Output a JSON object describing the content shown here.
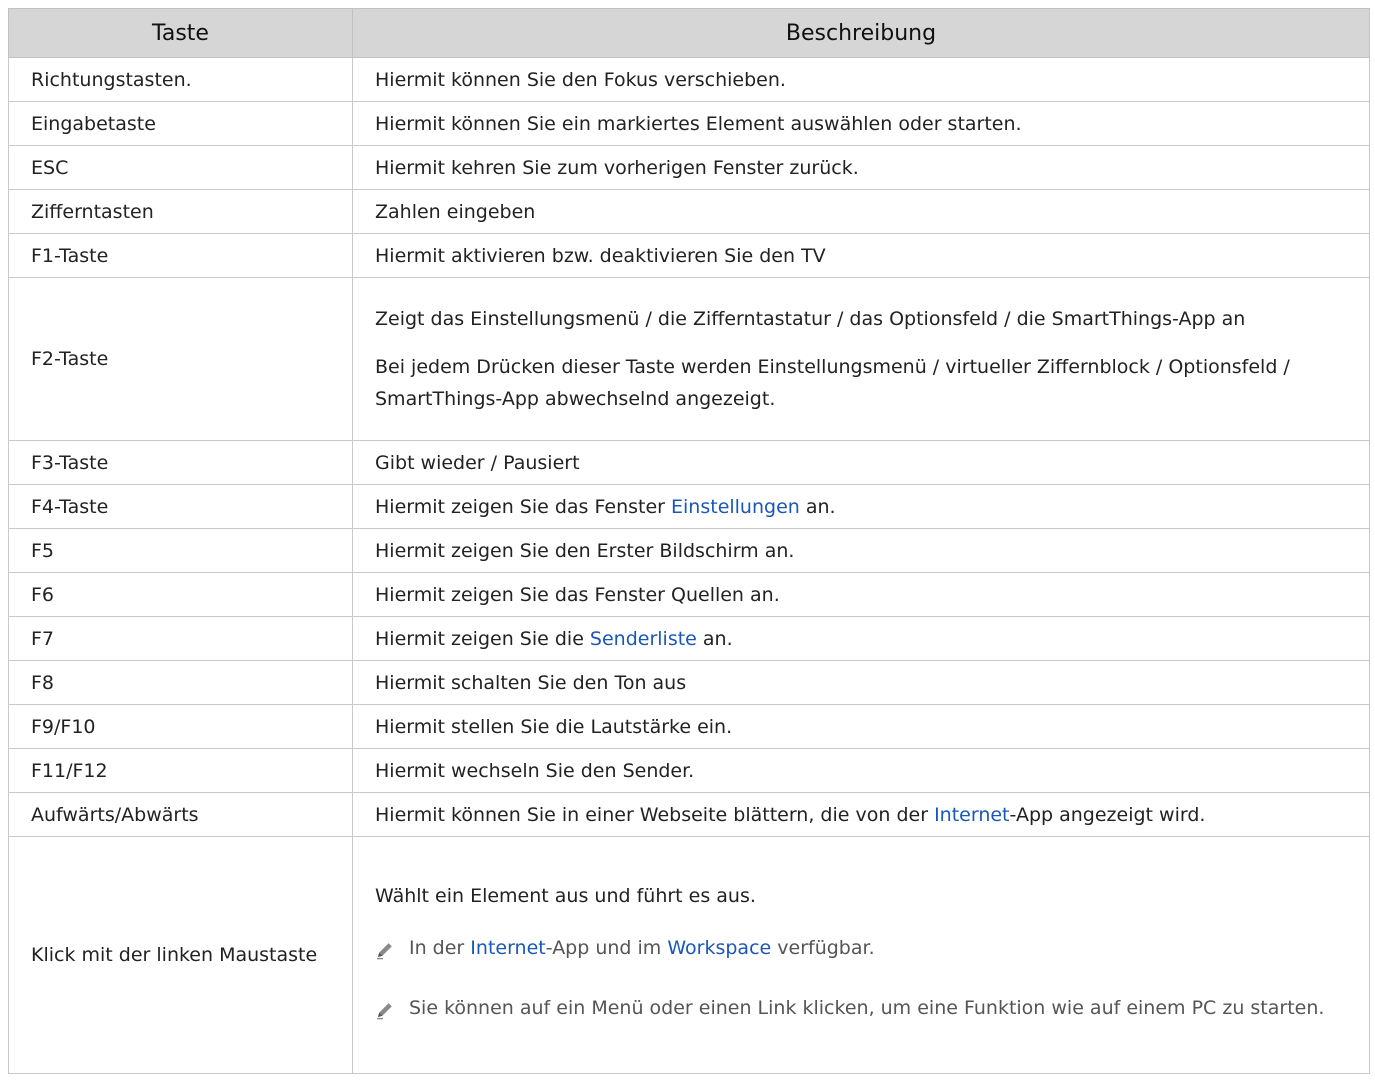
{
  "header": {
    "key": "Taste",
    "description": "Beschreibung"
  },
  "rows": [
    {
      "key": "Richtungstasten.",
      "desc": "Hiermit können Sie den Fokus verschieben."
    },
    {
      "key": "Eingabetaste",
      "desc": "Hiermit können Sie ein markiertes Element auswählen oder starten."
    },
    {
      "key": "ESC",
      "desc": "Hiermit kehren Sie zum vorherigen Fenster zurück."
    },
    {
      "key": "Zifferntasten",
      "desc": "Zahlen eingeben"
    },
    {
      "key": "F1-Taste",
      "desc": "Hiermit aktivieren bzw. deaktivieren Sie den TV"
    },
    {
      "key": "F2-Taste",
      "desc1": "Zeigt das Einstellungsmenü / die Zifferntastatur / das Optionsfeld / die SmartThings-App an",
      "desc2": "Bei jedem Drücken dieser Taste werden Einstellungsmenü / virtueller Ziffernblock / Optionsfeld / SmartThings-App abwechselnd angezeigt."
    },
    {
      "key": "F3-Taste",
      "desc": "Gibt wieder / Pausiert"
    },
    {
      "key": "F4-Taste",
      "desc_pre": "Hiermit zeigen Sie das Fenster ",
      "desc_link": "Einstellungen",
      "desc_post": " an."
    },
    {
      "key": "F5",
      "desc": "Hiermit zeigen Sie den Erster Bildschirm an."
    },
    {
      "key": "F6",
      "desc": "Hiermit zeigen Sie das Fenster Quellen an."
    },
    {
      "key": "F7",
      "desc_pre": "Hiermit zeigen Sie die ",
      "desc_link": "Senderliste",
      "desc_post": " an."
    },
    {
      "key": "F8",
      "desc": "Hiermit schalten Sie den Ton aus"
    },
    {
      "key": "F9/F10",
      "desc": "Hiermit stellen Sie die Lautstärke ein."
    },
    {
      "key": "F11/F12",
      "desc": "Hiermit wechseln Sie den Sender."
    },
    {
      "key": "Aufwärts/Abwärts",
      "desc_pre": "Hiermit können Sie in einer Webseite blättern, die von der ",
      "desc_link": "Internet",
      "desc_post": "-App angezeigt wird."
    },
    {
      "key": "Klick mit der linken Maustaste",
      "desc": "Wählt ein Element aus und führt es aus.",
      "note1_pre": "In der ",
      "note1_link1": "Internet",
      "note1_mid": "-App und im ",
      "note1_link2": "Workspace",
      "note1_post": " verfügbar.",
      "note2": "Sie können auf ein Menü oder einen Link klicken, um eine Funktion wie auf einem PC zu starten."
    }
  ],
  "colors": {
    "header_bg": "#d6d6d6",
    "link": "#1a57b8",
    "note_text": "#555555"
  },
  "icons": {
    "note": "pencil-icon"
  }
}
